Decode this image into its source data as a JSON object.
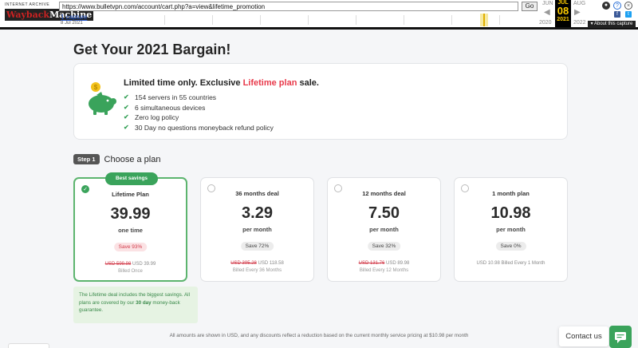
{
  "wayback": {
    "logo_top": "INTERNET ARCHIVE",
    "logo_main_a": "Wayback",
    "logo_main_b": "Machine",
    "url": "https://www.bulletvpn.com/account/cart.php?a=view&lifetime_promotion",
    "go_label": "Go",
    "captures_label": "1 capture",
    "capture_date": "8 Jul 2021",
    "prev_month": "JUN",
    "cur_month": "JUL",
    "next_month": "AUG",
    "cur_day": "08",
    "prev_year": "2020",
    "cur_year": "2021",
    "next_year": "2022",
    "about_label": "▾ About this capture"
  },
  "page": {
    "title": "Get Your 2021 Bargain!"
  },
  "promo": {
    "headline_pre": "Limited time only. Exclusive ",
    "headline_hl": "Lifetime plan",
    "headline_post": " sale.",
    "features": [
      "154 servers in 55 countries",
      "6 simultaneous devices",
      "Zero log policy",
      "30 Day no questions moneyback refund policy"
    ]
  },
  "step": {
    "badge": "Step 1",
    "label": "Choose a plan"
  },
  "plans": [
    {
      "name": "Lifetime Plan",
      "price": "39.99",
      "per": "one time",
      "save": "Save 93%",
      "orig": "USD 599.98",
      "now": " USD 39.99",
      "billed": "Billed Once",
      "best": "Best savings",
      "selected": true
    },
    {
      "name": "36 months deal",
      "price": "3.29",
      "per": "per month",
      "save": "Save 72%",
      "orig": "USD 395.28",
      "now": " USD 118.58",
      "billed": "Billed Every 36 Months",
      "selected": false
    },
    {
      "name": "12 months deal",
      "price": "7.50",
      "per": "per month",
      "save": "Save 32%",
      "orig": "USD 131.76",
      "now": " USD 89.98",
      "billed": "Billed Every 12 Months",
      "selected": false
    },
    {
      "name": "1 month plan",
      "price": "10.98",
      "per": "per month",
      "save": "Save 0%",
      "orig": "",
      "now": "USD 10.98 Billed Every 1 Month",
      "billed": "",
      "selected": false
    }
  ],
  "note": {
    "text_pre": "The Lifetime deal includes the biggest savings. All plans are covered by our ",
    "text_bold": "30 day",
    "text_post": " money-back guarantee."
  },
  "footer": {
    "disclaimer": "All amounts are shown in USD, and any discounts reflect a reduction based on the current monthly service pricing at $10.98 per month"
  },
  "widget": {
    "contact_label": "Contact us"
  },
  "colors": {
    "accent_green": "#3aa35b",
    "accent_red": "#e8394a"
  }
}
